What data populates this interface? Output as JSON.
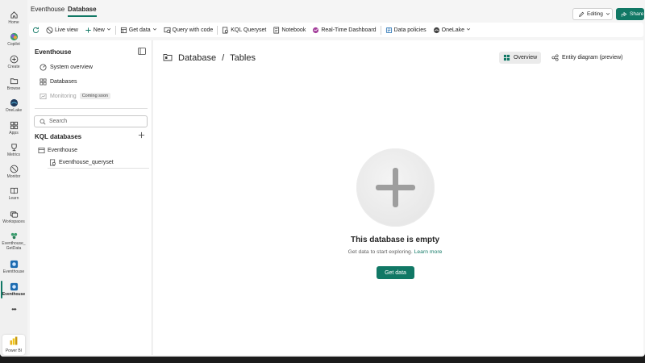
{
  "rail": {
    "items": [
      {
        "label": "Home",
        "icon": "home-icon"
      },
      {
        "label": "Copilot",
        "icon": "copilot-icon"
      },
      {
        "label": "Create",
        "icon": "create-icon"
      },
      {
        "label": "Browse",
        "icon": "browse-icon"
      },
      {
        "label": "OneLake",
        "icon": "onelake-icon"
      },
      {
        "label": "Apps",
        "icon": "apps-icon"
      },
      {
        "label": "Metrics",
        "icon": "metrics-icon"
      },
      {
        "label": "Monitor",
        "icon": "monitor-icon"
      },
      {
        "label": "Learn",
        "icon": "learn-icon"
      },
      {
        "label": "Workspaces",
        "icon": "workspaces-icon"
      },
      {
        "label": "Eventhouse_",
        "label2": "GetData",
        "icon": "eventhouse-getdata-icon"
      },
      {
        "label": "Eventhouse",
        "icon": "eventhouse-icon"
      },
      {
        "label": "Eventhouse",
        "icon": "eventhouse-active-icon"
      }
    ],
    "more": "•••",
    "power_bi": "Power BI"
  },
  "header": {
    "tabs": [
      "Eventhouse",
      "Database"
    ],
    "editing_label": "Editing",
    "share_label": "Share"
  },
  "toolbar": {
    "refresh_icon": "refresh-icon",
    "live_view": "Live view",
    "new": "New",
    "get_data": "Get data",
    "query_with_code": "Query with code",
    "kql_queryset": "KQL Queryset",
    "notebook": "Notebook",
    "realtime_dashboard": "Real-Time Dashboard",
    "data_policies": "Data policies",
    "onelake": "OneLake"
  },
  "leftpane": {
    "title": "Eventhouse",
    "nav": [
      {
        "label": "System overview"
      },
      {
        "label": "Databases"
      },
      {
        "label": "Monitoring",
        "badge": "Coming soon"
      }
    ],
    "search_placeholder": "Search",
    "kql_heading": "KQL databases",
    "tree": {
      "database": "Eventhouse",
      "queryset": "Eventhouse_queryset"
    }
  },
  "main": {
    "breadcrumb": {
      "part1": "Database",
      "sep": "/",
      "part2": "Tables"
    },
    "views": {
      "overview": "Overview",
      "entity_diagram": "Entity diagram (preview)"
    },
    "empty": {
      "title": "This database is empty",
      "desc": "Get data to start exploring.",
      "link": "Learn more",
      "button": "Get data"
    }
  },
  "colors": {
    "accent": "#117865"
  }
}
